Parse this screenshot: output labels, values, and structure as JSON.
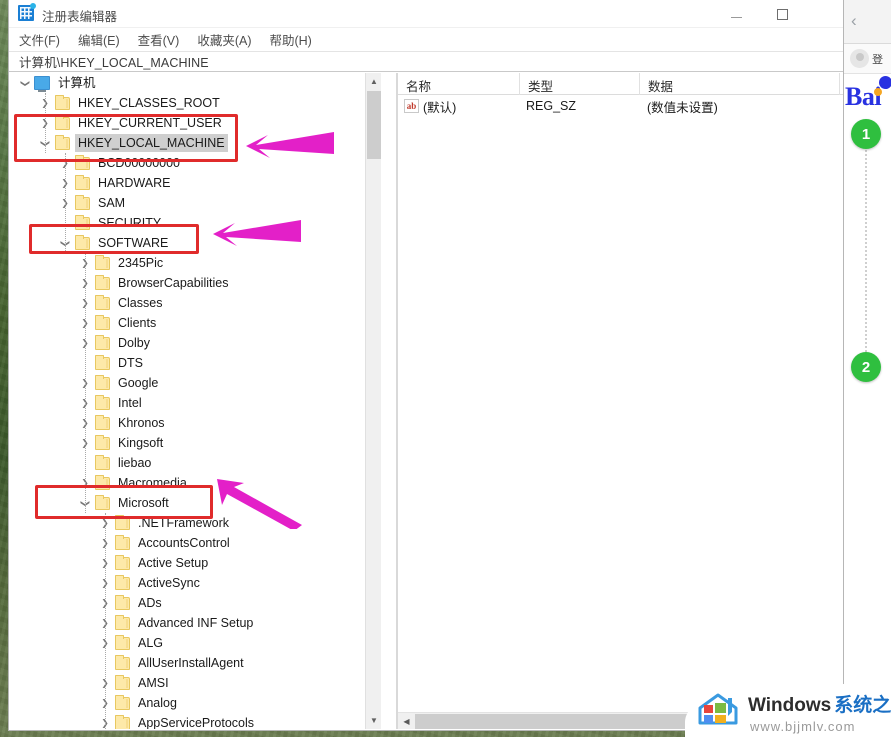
{
  "window": {
    "title": "注册表编辑器",
    "title_icon": "registry-icon",
    "minimize_label": "最小化",
    "maximize_label": "最大化"
  },
  "menu": {
    "items": [
      {
        "label": "文件(F)"
      },
      {
        "label": "编辑(E)"
      },
      {
        "label": "查看(V)"
      },
      {
        "label": "收藏夹(A)"
      },
      {
        "label": "帮助(H)"
      }
    ]
  },
  "address": {
    "path": "计算机\\HKEY_LOCAL_MACHINE"
  },
  "tree": {
    "root": {
      "label": "计算机",
      "icon": "computer-icon",
      "expanded": true
    },
    "nodes": [
      {
        "label": "HKEY_CLASSES_ROOT",
        "depth": 1,
        "state": "collapsed",
        "selected": false
      },
      {
        "label": "HKEY_CURRENT_USER",
        "depth": 1,
        "state": "collapsed",
        "selected": false
      },
      {
        "label": "HKEY_LOCAL_MACHINE",
        "depth": 1,
        "state": "expanded",
        "selected": true
      },
      {
        "label": "BCD00000000",
        "depth": 2,
        "state": "collapsed",
        "selected": false
      },
      {
        "label": "HARDWARE",
        "depth": 2,
        "state": "collapsed",
        "selected": false
      },
      {
        "label": "SAM",
        "depth": 2,
        "state": "collapsed",
        "selected": false
      },
      {
        "label": "SECURITY",
        "depth": 2,
        "state": "leaf",
        "selected": false
      },
      {
        "label": "SOFTWARE",
        "depth": 2,
        "state": "expanded",
        "selected": false
      },
      {
        "label": "2345Pic",
        "depth": 3,
        "state": "collapsed",
        "selected": false
      },
      {
        "label": "BrowserCapabilities",
        "depth": 3,
        "state": "collapsed",
        "selected": false
      },
      {
        "label": "Classes",
        "depth": 3,
        "state": "collapsed",
        "selected": false
      },
      {
        "label": "Clients",
        "depth": 3,
        "state": "collapsed",
        "selected": false
      },
      {
        "label": "Dolby",
        "depth": 3,
        "state": "collapsed",
        "selected": false
      },
      {
        "label": "DTS",
        "depth": 3,
        "state": "leaf",
        "selected": false
      },
      {
        "label": "Google",
        "depth": 3,
        "state": "collapsed",
        "selected": false
      },
      {
        "label": "Intel",
        "depth": 3,
        "state": "collapsed",
        "selected": false
      },
      {
        "label": "Khronos",
        "depth": 3,
        "state": "collapsed",
        "selected": false
      },
      {
        "label": "Kingsoft",
        "depth": 3,
        "state": "collapsed",
        "selected": false
      },
      {
        "label": "liebao",
        "depth": 3,
        "state": "leaf",
        "selected": false
      },
      {
        "label": "Macromedia",
        "depth": 3,
        "state": "collapsed",
        "selected": false
      },
      {
        "label": "Microsoft",
        "depth": 3,
        "state": "expanded",
        "selected": false
      },
      {
        "label": ".NETFramework",
        "depth": 4,
        "state": "collapsed",
        "selected": false
      },
      {
        "label": "AccountsControl",
        "depth": 4,
        "state": "collapsed",
        "selected": false
      },
      {
        "label": "Active Setup",
        "depth": 4,
        "state": "collapsed",
        "selected": false
      },
      {
        "label": "ActiveSync",
        "depth": 4,
        "state": "collapsed",
        "selected": false
      },
      {
        "label": "ADs",
        "depth": 4,
        "state": "collapsed",
        "selected": false
      },
      {
        "label": "Advanced INF Setup",
        "depth": 4,
        "state": "collapsed",
        "selected": false
      },
      {
        "label": "ALG",
        "depth": 4,
        "state": "collapsed",
        "selected": false
      },
      {
        "label": "AllUserInstallAgent",
        "depth": 4,
        "state": "leaf",
        "selected": false
      },
      {
        "label": "AMSI",
        "depth": 4,
        "state": "collapsed",
        "selected": false
      },
      {
        "label": "Analog",
        "depth": 4,
        "state": "collapsed",
        "selected": false
      },
      {
        "label": "AppServiceProtocols",
        "depth": 4,
        "state": "collapsed",
        "selected": false
      }
    ]
  },
  "values": {
    "columns": [
      "名称",
      "类型",
      "数据"
    ],
    "rows": [
      {
        "name": "(默认)",
        "type": "REG_SZ",
        "data": "(数值未设置)",
        "icon": "string-value-icon"
      }
    ]
  },
  "browser": {
    "back_label": "‹",
    "login_label": "登",
    "logo": "Bai"
  },
  "annotations": {
    "steps": [
      {
        "number": "1"
      },
      {
        "number": "2"
      }
    ],
    "box_color": "#e02b2b",
    "arrow_color": "#e320c8",
    "step_color": "#2fbf3f"
  },
  "watermark": {
    "brand": "Windows",
    "brand_cn": "系统之家",
    "url": "www.bjjmlv.com"
  }
}
